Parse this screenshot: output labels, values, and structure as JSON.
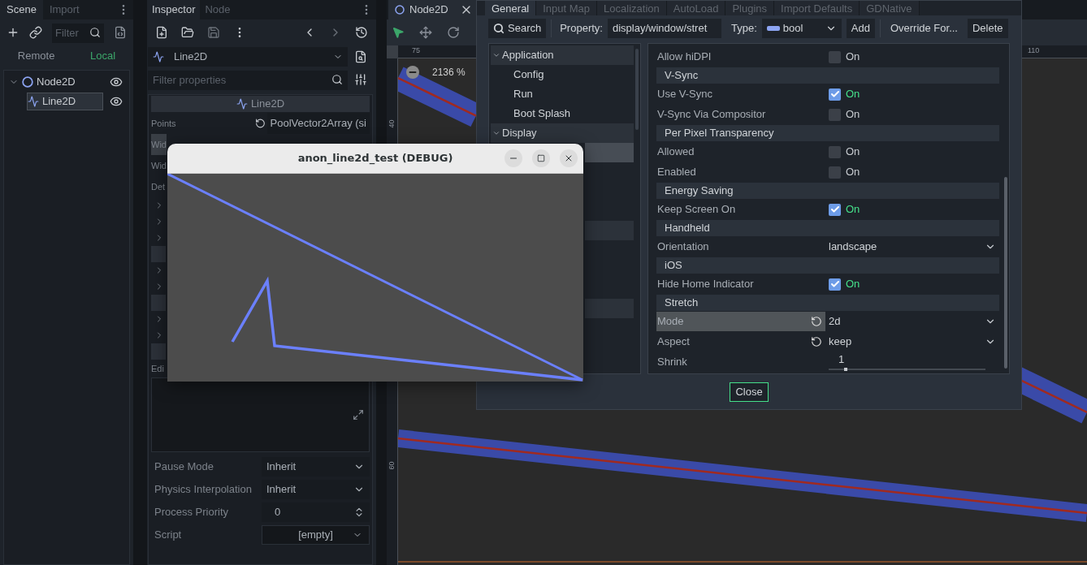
{
  "scene_dock": {
    "tabs": [
      {
        "label": "Scene",
        "selected": true
      },
      {
        "label": "Import",
        "selected": false
      }
    ],
    "filter": {
      "placeholder": "Filter"
    },
    "modes": [
      {
        "label": "Remote",
        "selected": false
      },
      {
        "label": "Local",
        "selected": true
      }
    ],
    "tree": [
      {
        "label": "Node2D",
        "kind": "node2d",
        "selected": false,
        "visible": true,
        "children": [
          {
            "label": "Line2D",
            "kind": "line2d",
            "selected": true,
            "visible": true
          }
        ]
      }
    ]
  },
  "inspector": {
    "tabs": [
      {
        "label": "Inspector",
        "selected": true
      },
      {
        "label": "Node",
        "selected": false
      }
    ],
    "object": "Line2D",
    "filter": {
      "placeholder": "Filter properties"
    },
    "section_title": "Line2D",
    "rows": [
      {
        "kind": "property",
        "label": "Points",
        "value": "PoolVector2Array (si",
        "revertible": true,
        "highlighted": false
      },
      {
        "kind": "property",
        "label": "Wid",
        "highlighted": true
      },
      {
        "kind": "property",
        "label": "Wid",
        "highlighted": false
      },
      {
        "kind": "property",
        "label": "Det",
        "highlighted": false
      },
      {
        "kind": "group"
      },
      {
        "kind": "group"
      },
      {
        "kind": "group"
      },
      {
        "kind": "bar"
      },
      {
        "kind": "group"
      },
      {
        "kind": "group"
      },
      {
        "kind": "bar"
      },
      {
        "kind": "group"
      },
      {
        "kind": "group"
      },
      {
        "kind": "bar"
      },
      {
        "kind": "label",
        "label": "Edi"
      },
      {
        "kind": "editor"
      },
      {
        "kind": "select",
        "label": "Pause Mode",
        "value": "Inherit"
      },
      {
        "kind": "select",
        "label": "Physics Interpolation",
        "value": "Inherit"
      },
      {
        "kind": "spin",
        "label": "Process Priority",
        "value": "0"
      },
      {
        "kind": "resource",
        "label": "Script",
        "value": "[empty]"
      }
    ]
  },
  "editor_tabs": [
    {
      "label": "Node2D",
      "selected": true
    }
  ],
  "canvas": {
    "zoom": "2136 %",
    "ruler_marks": [
      {
        "kind": "top",
        "text": "75"
      },
      {
        "kind": "top",
        "text": "110"
      },
      {
        "kind": "left",
        "text": "40"
      },
      {
        "kind": "left",
        "text": "60"
      }
    ]
  },
  "project_settings": {
    "tabs": [
      {
        "label": "General",
        "selected": true
      },
      {
        "label": "Input Map",
        "selected": false
      },
      {
        "label": "Localization",
        "selected": false
      },
      {
        "label": "AutoLoad",
        "selected": false
      },
      {
        "label": "Plugins",
        "selected": false
      },
      {
        "label": "Import Defaults",
        "selected": false
      },
      {
        "label": "GDNative",
        "selected": false
      }
    ],
    "search_button": "Search",
    "property_label": "Property:",
    "property_value": "display/window/stret",
    "type_label": "Type:",
    "type_value": "bool",
    "buttons": [
      "Add",
      "Override For...",
      "Delete"
    ],
    "tree": [
      {
        "kind": "category",
        "label": "Application",
        "expanded": true,
        "selected": false
      },
      {
        "kind": "item",
        "label": "Config",
        "selected": false
      },
      {
        "kind": "item",
        "label": "Run",
        "selected": false
      },
      {
        "kind": "item",
        "label": "Boot Splash",
        "selected": false
      },
      {
        "kind": "category",
        "label": "Display",
        "expanded": true,
        "selected": false
      },
      {
        "kind": "item",
        "selected": true
      },
      {
        "kind": "category",
        "selected": false
      },
      {
        "kind": "category",
        "selected": false
      }
    ],
    "rows": [
      {
        "kind": "check",
        "label": "Allow hiDPI",
        "text": "On",
        "checked": false
      },
      {
        "kind": "section",
        "label": "V-Sync"
      },
      {
        "kind": "check",
        "label": "Use V-Sync",
        "text": "On",
        "checked": true
      },
      {
        "kind": "check",
        "label": "V-Sync Via Compositor",
        "text": "On",
        "checked": false
      },
      {
        "kind": "section",
        "label": "Per Pixel Transparency"
      },
      {
        "kind": "check",
        "label": "Allowed",
        "text": "On",
        "checked": false
      },
      {
        "kind": "check",
        "label": "Enabled",
        "text": "On",
        "checked": false
      },
      {
        "kind": "section",
        "label": "Energy Saving"
      },
      {
        "kind": "check",
        "label": "Keep Screen On",
        "text": "On",
        "checked": true
      },
      {
        "kind": "section",
        "label": "Handheld"
      },
      {
        "kind": "select",
        "label": "Orientation",
        "value": "landscape"
      },
      {
        "kind": "section",
        "label": "iOS"
      },
      {
        "kind": "check",
        "label": "Hide Home Indicator",
        "text": "On",
        "checked": true
      },
      {
        "kind": "section",
        "label": "Stretch"
      },
      {
        "kind": "select",
        "label": "Mode",
        "value": "2d",
        "revertible": true,
        "highlighted": true
      },
      {
        "kind": "select",
        "label": "Aspect",
        "value": "keep",
        "revertible": true
      },
      {
        "kind": "slider",
        "label": "Shrink",
        "value": "1",
        "level": 0.11
      }
    ],
    "close_button": "Close"
  },
  "debug_window": {
    "title": "anon_line2d_test (DEBUG)"
  }
}
